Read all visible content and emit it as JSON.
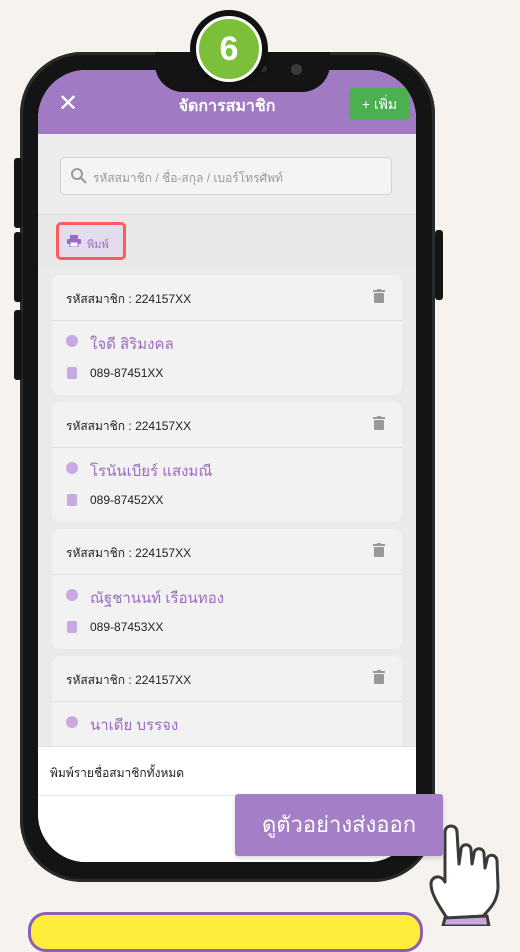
{
  "step": {
    "number": "6"
  },
  "header": {
    "close_label": "✕",
    "title": "จัดการสมาชิก",
    "add_label": "+ เพิ่ม"
  },
  "search": {
    "placeholder": "รหัสสมาชิก / ชื่อ-สกุล / เบอร์โทรศัพท์"
  },
  "toolbar": {
    "print_label": "พิมพ์"
  },
  "members": [
    {
      "code": "รหัสสมาชิก : 224157XX",
      "name": "ใจดี สิริมงคล",
      "phone": "089-87451XX"
    },
    {
      "code": "รหัสสมาชิก : 224157XX",
      "name": "โรนันเบียร์  แสงมณี",
      "phone": "089-87452XX"
    },
    {
      "code": "รหัสสมาชิก : 224157XX",
      "name": "ณัฐชานนท์   เรือนทอง",
      "phone": "089-87453XX"
    },
    {
      "code": "รหัสสมาชิก : 224157XX",
      "name": "นาเดีย  บรรจง",
      "phone": ""
    }
  ],
  "sheet": {
    "print_all_label": "พิมพ์รายชื่อสมาชิกทั้งหมด"
  },
  "callout": {
    "preview_label": "ดูตัวอย่างส่งออก"
  },
  "colors": {
    "header": "#a07ac2",
    "add": "#4caf50",
    "accent": "#9b6bc2",
    "highlight": "#ff5b5b",
    "badge": "#7bbf3a",
    "note": "#ffec3b"
  }
}
